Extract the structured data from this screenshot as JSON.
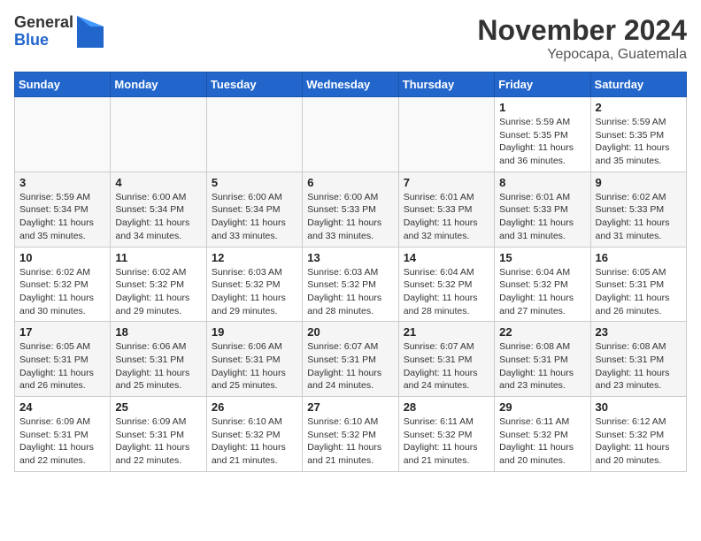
{
  "logo": {
    "general": "General",
    "blue": "Blue"
  },
  "title": "November 2024",
  "subtitle": "Yepocapa, Guatemala",
  "weekdays": [
    "Sunday",
    "Monday",
    "Tuesday",
    "Wednesday",
    "Thursday",
    "Friday",
    "Saturday"
  ],
  "weeks": [
    [
      {
        "day": "",
        "info": ""
      },
      {
        "day": "",
        "info": ""
      },
      {
        "day": "",
        "info": ""
      },
      {
        "day": "",
        "info": ""
      },
      {
        "day": "",
        "info": ""
      },
      {
        "day": "1",
        "info": "Sunrise: 5:59 AM\nSunset: 5:35 PM\nDaylight: 11 hours\nand 36 minutes."
      },
      {
        "day": "2",
        "info": "Sunrise: 5:59 AM\nSunset: 5:35 PM\nDaylight: 11 hours\nand 35 minutes."
      }
    ],
    [
      {
        "day": "3",
        "info": "Sunrise: 5:59 AM\nSunset: 5:34 PM\nDaylight: 11 hours\nand 35 minutes."
      },
      {
        "day": "4",
        "info": "Sunrise: 6:00 AM\nSunset: 5:34 PM\nDaylight: 11 hours\nand 34 minutes."
      },
      {
        "day": "5",
        "info": "Sunrise: 6:00 AM\nSunset: 5:34 PM\nDaylight: 11 hours\nand 33 minutes."
      },
      {
        "day": "6",
        "info": "Sunrise: 6:00 AM\nSunset: 5:33 PM\nDaylight: 11 hours\nand 33 minutes."
      },
      {
        "day": "7",
        "info": "Sunrise: 6:01 AM\nSunset: 5:33 PM\nDaylight: 11 hours\nand 32 minutes."
      },
      {
        "day": "8",
        "info": "Sunrise: 6:01 AM\nSunset: 5:33 PM\nDaylight: 11 hours\nand 31 minutes."
      },
      {
        "day": "9",
        "info": "Sunrise: 6:02 AM\nSunset: 5:33 PM\nDaylight: 11 hours\nand 31 minutes."
      }
    ],
    [
      {
        "day": "10",
        "info": "Sunrise: 6:02 AM\nSunset: 5:32 PM\nDaylight: 11 hours\nand 30 minutes."
      },
      {
        "day": "11",
        "info": "Sunrise: 6:02 AM\nSunset: 5:32 PM\nDaylight: 11 hours\nand 29 minutes."
      },
      {
        "day": "12",
        "info": "Sunrise: 6:03 AM\nSunset: 5:32 PM\nDaylight: 11 hours\nand 29 minutes."
      },
      {
        "day": "13",
        "info": "Sunrise: 6:03 AM\nSunset: 5:32 PM\nDaylight: 11 hours\nand 28 minutes."
      },
      {
        "day": "14",
        "info": "Sunrise: 6:04 AM\nSunset: 5:32 PM\nDaylight: 11 hours\nand 28 minutes."
      },
      {
        "day": "15",
        "info": "Sunrise: 6:04 AM\nSunset: 5:32 PM\nDaylight: 11 hours\nand 27 minutes."
      },
      {
        "day": "16",
        "info": "Sunrise: 6:05 AM\nSunset: 5:31 PM\nDaylight: 11 hours\nand 26 minutes."
      }
    ],
    [
      {
        "day": "17",
        "info": "Sunrise: 6:05 AM\nSunset: 5:31 PM\nDaylight: 11 hours\nand 26 minutes."
      },
      {
        "day": "18",
        "info": "Sunrise: 6:06 AM\nSunset: 5:31 PM\nDaylight: 11 hours\nand 25 minutes."
      },
      {
        "day": "19",
        "info": "Sunrise: 6:06 AM\nSunset: 5:31 PM\nDaylight: 11 hours\nand 25 minutes."
      },
      {
        "day": "20",
        "info": "Sunrise: 6:07 AM\nSunset: 5:31 PM\nDaylight: 11 hours\nand 24 minutes."
      },
      {
        "day": "21",
        "info": "Sunrise: 6:07 AM\nSunset: 5:31 PM\nDaylight: 11 hours\nand 24 minutes."
      },
      {
        "day": "22",
        "info": "Sunrise: 6:08 AM\nSunset: 5:31 PM\nDaylight: 11 hours\nand 23 minutes."
      },
      {
        "day": "23",
        "info": "Sunrise: 6:08 AM\nSunset: 5:31 PM\nDaylight: 11 hours\nand 23 minutes."
      }
    ],
    [
      {
        "day": "24",
        "info": "Sunrise: 6:09 AM\nSunset: 5:31 PM\nDaylight: 11 hours\nand 22 minutes."
      },
      {
        "day": "25",
        "info": "Sunrise: 6:09 AM\nSunset: 5:31 PM\nDaylight: 11 hours\nand 22 minutes."
      },
      {
        "day": "26",
        "info": "Sunrise: 6:10 AM\nSunset: 5:32 PM\nDaylight: 11 hours\nand 21 minutes."
      },
      {
        "day": "27",
        "info": "Sunrise: 6:10 AM\nSunset: 5:32 PM\nDaylight: 11 hours\nand 21 minutes."
      },
      {
        "day": "28",
        "info": "Sunrise: 6:11 AM\nSunset: 5:32 PM\nDaylight: 11 hours\nand 21 minutes."
      },
      {
        "day": "29",
        "info": "Sunrise: 6:11 AM\nSunset: 5:32 PM\nDaylight: 11 hours\nand 20 minutes."
      },
      {
        "day": "30",
        "info": "Sunrise: 6:12 AM\nSunset: 5:32 PM\nDaylight: 11 hours\nand 20 minutes."
      }
    ]
  ]
}
